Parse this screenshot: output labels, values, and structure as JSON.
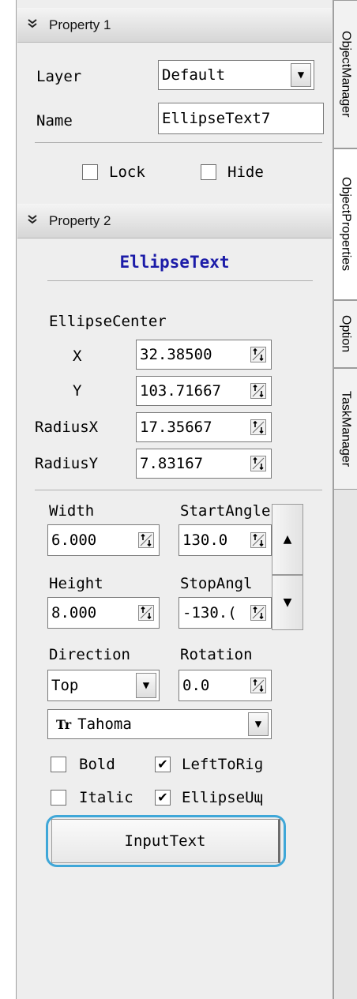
{
  "property1": {
    "header": "Property 1",
    "layer_label": "Layer",
    "layer_value": "Default",
    "name_label": "Name",
    "name_value": "EllipseText7",
    "lock_label": "Lock",
    "lock_checked": false,
    "hide_label": "Hide",
    "hide_checked": false
  },
  "property2": {
    "header": "Property 2",
    "object_type": "EllipseText",
    "ellipse_center_label": "EllipseCenter",
    "x_label": "X",
    "x_value": "32.38500",
    "y_label": "Y",
    "y_value": "103.71667",
    "radius_x_label": "RadiusX",
    "radius_x_value": "17.35667",
    "radius_y_label": "RadiusY",
    "radius_y_value": "7.83167",
    "width_label": "Width",
    "width_value": "6.000",
    "start_angle_label": "StartAngle",
    "start_angle_value": "130.0",
    "height_label": "Height",
    "height_value": "8.000",
    "stop_angle_label": "StopAngl",
    "stop_angle_value": "-130.(",
    "direction_label": "Direction",
    "direction_value": "Top",
    "rotation_label": "Rotation",
    "rotation_value": "0.0",
    "font_glyph": "Tr",
    "font_value": "Tahoma",
    "bold_label": "Bold",
    "bold_checked": false,
    "left_to_right_label": "LeftToRiɡ",
    "left_to_right_checked": true,
    "italic_label": "Italic",
    "italic_checked": false,
    "ellipse_up_label": "EllipseUɰ",
    "ellipse_up_checked": true,
    "input_text_button": "InputText"
  },
  "side_tabs": [
    "ObjectManager",
    "ObjectProperties",
    "Option",
    "TaskManager"
  ],
  "colors": {
    "object_type_text": "#1c1ca8",
    "highlight_ring": "#3fa7d8"
  },
  "icons": {
    "section_collapse": "double-chevron-down-icon",
    "dropdown": "triangle-down-icon",
    "spinner": "spin-arrows-icon",
    "check": "checkmark-icon"
  }
}
